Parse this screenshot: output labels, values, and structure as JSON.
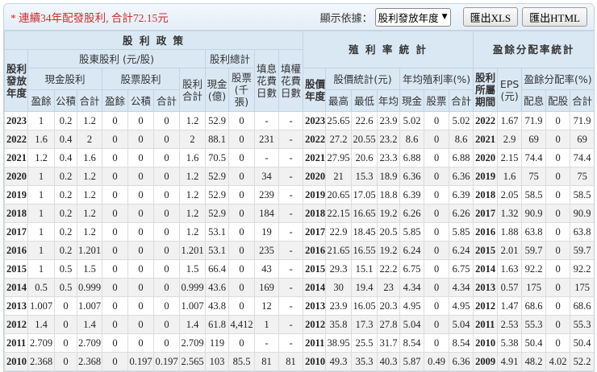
{
  "toolbar": {
    "note": "* 連續34年配發股利, 合計72.15元",
    "display_label": "顯示依據：",
    "display_value": "股利發放年度",
    "export_xls": "匯出XLS",
    "export_html": "匯出HTML"
  },
  "headers": {
    "policy": "股 利 政 策",
    "yield_stats": "殖 利 率 統 計",
    "payout_stats": "盈餘分配率統計",
    "dist_year": "股利發放年度",
    "shareholder_div": "股東股利 (元/股)",
    "div_total": "股利總計",
    "fill_div_days": "填息花費日數",
    "fill_right_days": "填權花費日數",
    "cash_div": "現金股利",
    "stock_div": "股票股利",
    "div_sum": "股利合計",
    "cash_100m": "現金(億)",
    "stock_k": "股票(千張)",
    "earnings": "盈餘",
    "reserve": "公積",
    "total": "合計",
    "price_year": "股價年度",
    "price_stats": "股價統計(元)",
    "avg_yield": "年均殖利率(%)",
    "high": "最高",
    "low": "最低",
    "avg": "年均",
    "cash": "現金",
    "stock": "股票",
    "period": "股利所屬期間",
    "eps": "EPS (元)",
    "payout": "盈餘分配率(%)",
    "pay_div": "配息",
    "pay_stock": "配股"
  },
  "rows": [
    [
      "2023",
      "1",
      "0.2",
      "1.2",
      "0",
      "0",
      "0",
      "1.2",
      "52.9",
      "0",
      "-",
      "-",
      "2023",
      "25.65",
      "22.6",
      "23.9",
      "5.02",
      "0",
      "5.02",
      "2022",
      "1.67",
      "71.9",
      "0",
      "71.9"
    ],
    [
      "2022",
      "1.6",
      "0.4",
      "2",
      "0",
      "0",
      "0",
      "2",
      "88.1",
      "0",
      "231",
      "-",
      "2022",
      "27.2",
      "20.55",
      "23.2",
      "8.6",
      "0",
      "8.6",
      "2021",
      "2.9",
      "69",
      "0",
      "69"
    ],
    [
      "2021",
      "1.2",
      "0.4",
      "1.6",
      "0",
      "0",
      "0",
      "1.6",
      "70.5",
      "0",
      "-",
      "-",
      "2021",
      "27.95",
      "20.6",
      "23.3",
      "6.88",
      "0",
      "6.88",
      "2020",
      "2.15",
      "74.4",
      "0",
      "74.4"
    ],
    [
      "2020",
      "1",
      "0.2",
      "1.2",
      "0",
      "0",
      "0",
      "1.2",
      "52.9",
      "0",
      "34",
      "-",
      "2020",
      "21",
      "15.3",
      "18.9",
      "6.36",
      "0",
      "6.36",
      "2019",
      "1.6",
      "75",
      "0",
      "75"
    ],
    [
      "2019",
      "1",
      "0.2",
      "1.2",
      "0",
      "0",
      "0",
      "1.2",
      "52.9",
      "0",
      "239",
      "-",
      "2019",
      "20.65",
      "17.05",
      "18.8",
      "6.39",
      "0",
      "6.39",
      "2018",
      "2.05",
      "58.5",
      "0",
      "58.5"
    ],
    [
      "2018",
      "1",
      "0.2",
      "1.2",
      "0",
      "0",
      "0",
      "1.2",
      "52.9",
      "0",
      "184",
      "-",
      "2018",
      "22.15",
      "16.65",
      "19.2",
      "6.26",
      "0",
      "6.26",
      "2017",
      "1.32",
      "90.9",
      "0",
      "90.9"
    ],
    [
      "2017",
      "1",
      "0.2",
      "1.2",
      "0",
      "0",
      "0",
      "1.2",
      "53.1",
      "0",
      "19",
      "-",
      "2017",
      "22.9",
      "18.45",
      "20.5",
      "5.85",
      "0",
      "5.85",
      "2016",
      "1.88",
      "63.8",
      "0",
      "63.8"
    ],
    [
      "2016",
      "1",
      "0.2",
      "1.201",
      "0",
      "0",
      "0",
      "1.201",
      "53.1",
      "0",
      "235",
      "-",
      "2016",
      "21.65",
      "16.55",
      "19.2",
      "6.24",
      "0",
      "6.24",
      "2015",
      "2.01",
      "59.7",
      "0",
      "59.7"
    ],
    [
      "2015",
      "1",
      "0.5",
      "1.5",
      "0",
      "0",
      "0",
      "1.5",
      "66.4",
      "0",
      "43",
      "-",
      "2015",
      "29.3",
      "15.1",
      "22.2",
      "6.75",
      "0",
      "6.75",
      "2014",
      "1.63",
      "92.2",
      "0",
      "92.2"
    ],
    [
      "2014",
      "0.5",
      "0.5",
      "0.999",
      "0",
      "0",
      "0",
      "0.999",
      "43.6",
      "0",
      "169",
      "-",
      "2014",
      "30",
      "19.4",
      "23",
      "4.34",
      "0",
      "4.34",
      "2013",
      "0.57",
      "175",
      "0",
      "175"
    ],
    [
      "2013",
      "1.007",
      "0",
      "1.007",
      "0",
      "0",
      "0",
      "1.007",
      "43.8",
      "0",
      "12",
      "-",
      "2013",
      "23.9",
      "16.05",
      "20.3",
      "4.95",
      "0",
      "4.95",
      "2012",
      "1.47",
      "68.6",
      "0",
      "68.6"
    ],
    [
      "2012",
      "1.4",
      "0",
      "1.4",
      "0",
      "0",
      "0",
      "1.4",
      "61.8",
      "4,412",
      "1",
      "-",
      "2012",
      "35.8",
      "17.3",
      "27.8",
      "5.04",
      "0",
      "5.04",
      "2011",
      "2.53",
      "55.3",
      "0",
      "55.3"
    ],
    [
      "2011",
      "2.709",
      "0",
      "2.709",
      "0",
      "0",
      "0",
      "2.709",
      "119",
      "0",
      "-",
      "-",
      "2011",
      "38.95",
      "25.5",
      "31.7",
      "8.54",
      "0",
      "8.54",
      "2010",
      "5.38",
      "50.4",
      "0",
      "50.4"
    ],
    [
      "2010",
      "2.368",
      "0",
      "2.368",
      "0",
      "0.197",
      "0.197",
      "2.565",
      "103",
      "85.5",
      "81",
      "81",
      "2010",
      "49.3",
      "35.3",
      "40.3",
      "5.87",
      "0.49",
      "6.36",
      "2009",
      "4.91",
      "48.2",
      "4.02",
      "52.2"
    ]
  ]
}
